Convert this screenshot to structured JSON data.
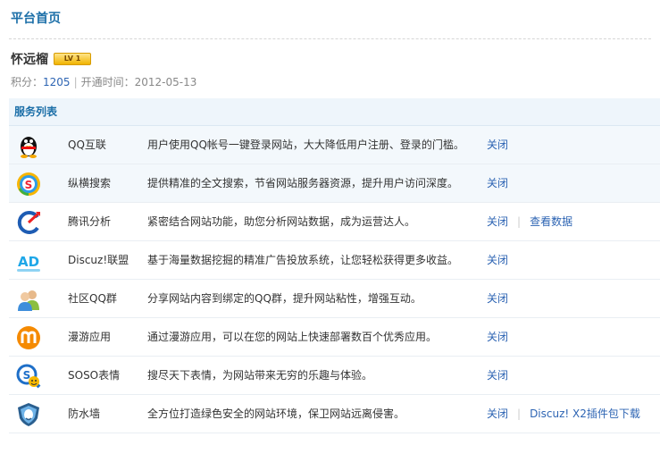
{
  "header": {
    "title": "平台首页"
  },
  "user": {
    "name": "怀远榴",
    "level_badge": "LV 1",
    "score_label": "积分：",
    "score": "1205",
    "separator": "|",
    "open_label": "开通时间：",
    "open_date": "2012-05-13"
  },
  "services": {
    "title": "服务列表",
    "items": [
      {
        "icon": "qq-penguin-icon",
        "name": "QQ互联",
        "desc": "用户使用QQ帐号一键登录网站，大大降低用户注册、登录的门槛。",
        "actions": [
          "关闭"
        ]
      },
      {
        "icon": "soso-search-icon",
        "name": "纵横搜索",
        "desc": "提供精准的全文搜索，节省网站服务器资源，提升用户访问深度。",
        "actions": [
          "关闭"
        ]
      },
      {
        "icon": "tencent-analytics-icon",
        "name": "腾讯分析",
        "desc": "紧密结合网站功能，助您分析网站数据，成为运营达人。",
        "actions": [
          "关闭",
          "查看数据"
        ]
      },
      {
        "icon": "ad-union-icon",
        "name": "Discuz!联盟",
        "desc": "基于海量数据挖掘的精准广告投放系统，让您轻松获得更多收益。",
        "actions": [
          "关闭"
        ]
      },
      {
        "icon": "qq-group-icon",
        "name": "社区QQ群",
        "desc": "分享网站内容到绑定的QQ群，提升网站粘性，增强互动。",
        "actions": [
          "关闭"
        ]
      },
      {
        "icon": "manyou-app-icon",
        "name": "漫游应用",
        "desc": "通过漫游应用，可以在您的网站上快速部署数百个优秀应用。",
        "actions": [
          "关闭"
        ]
      },
      {
        "icon": "soso-emoticon-icon",
        "name": "SOSO表情",
        "desc": "搜尽天下表情，为网站带来无穷的乐趣与体验。",
        "actions": [
          "关闭"
        ]
      },
      {
        "icon": "firewall-shield-icon",
        "name": "防水墙",
        "desc": "全方位打造绿色安全的网站环境，保卫网站远离侵害。",
        "actions": [
          "关闭",
          "Discuz! X2插件包下载"
        ]
      }
    ]
  }
}
